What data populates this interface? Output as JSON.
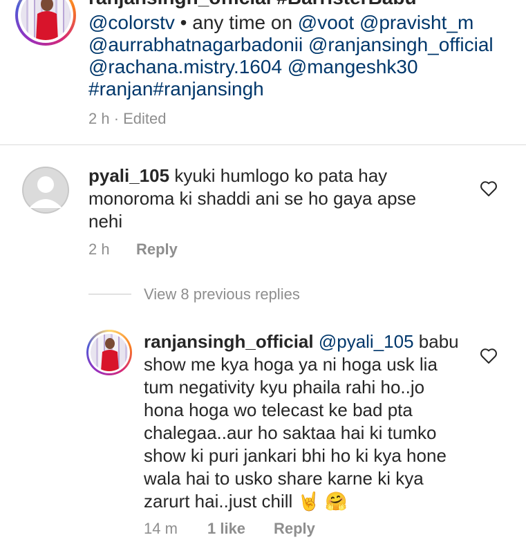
{
  "caption": {
    "top_partial": "ranjansingh_official #BarristerBabu",
    "lines": [
      [
        {
          "t": "@colorstv",
          "link": true
        },
        {
          "t": " • any time on ",
          "link": false
        },
        {
          "t": "@voot",
          "link": true
        },
        {
          "t": " ",
          "link": false
        },
        {
          "t": "@pravisht_m",
          "link": true
        }
      ],
      [
        {
          "t": "@aurrabhatnagarbadonii",
          "link": true
        },
        {
          "t": " ",
          "link": false
        },
        {
          "t": "@ranjansingh_official",
          "link": true
        }
      ],
      [
        {
          "t": "@rachana.mistry.1604",
          "link": true
        },
        {
          "t": " ",
          "link": false
        },
        {
          "t": "@mangeshk30",
          "link": true
        }
      ],
      [
        {
          "t": "#ranjan#ranjansingh",
          "link": true
        }
      ]
    ],
    "meta": "2 h · Edited"
  },
  "comment": {
    "username": "pyali_105",
    "line1": "kyuki humlogo ko pata hay",
    "line2": "monoroma ki shaddi ani se ho gaya apse",
    "line3": "nehi",
    "time": "2 h",
    "reply_label": "Reply"
  },
  "view_replies": "View 8 previous replies",
  "reply": {
    "username": "ranjansingh_official",
    "mention": "@pyali_105",
    "line1_tail": " babu",
    "lines": [
      "show me kya hoga ya ni hoga usk lia",
      "tum negativity kyu phaila rahi ho..jo",
      "hona hoga wo telecast ke bad pta",
      "chalegaa..aur ho saktaa hai ki tumko",
      "show ki puri jankari bhi ho ki kya hone",
      "wala hai to usko share karne ki kya"
    ],
    "last_line": "zarurt hai..just chill",
    "emoji1": "🤘",
    "emoji2": "🤗",
    "time": "14 m",
    "likes": "1 like",
    "reply_label": "Reply"
  },
  "icons": {
    "heart": "heart-outline-icon",
    "default_avatar": "default-user-avatar-icon",
    "profile_avatar": "profile-photo-icon"
  },
  "colors": {
    "link": "#00376b",
    "meta": "#8e8e8e",
    "text": "#262626",
    "divider": "#dbdbdb"
  }
}
